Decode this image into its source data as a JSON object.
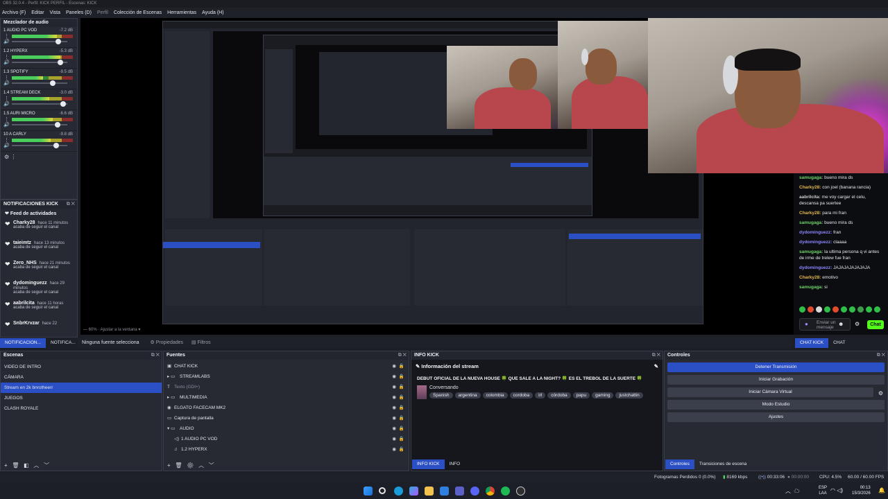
{
  "window": {
    "title": "OBS 32.0.4 - Perfil: KICK PERFIL - Escenas: KICK"
  },
  "menu": [
    {
      "label": "Archivo (F)",
      "dim": false
    },
    {
      "label": "Editar",
      "dim": false
    },
    {
      "label": "Vista",
      "dim": false
    },
    {
      "label": "Paneles (D)",
      "dim": false
    },
    {
      "label": "Perfil",
      "dim": true
    },
    {
      "label": "Colección de Escenas",
      "dim": false
    },
    {
      "label": "Herramientas",
      "dim": false
    },
    {
      "label": "Ayuda (H)",
      "dim": false
    }
  ],
  "mixer": {
    "title": "Mezclador de audio",
    "tracks": [
      {
        "name": "1 AUDIO PC VOD",
        "db": "-7.2 dB",
        "level": 0.72,
        "volume": 0.82
      },
      {
        "name": "1.2 HYPERX",
        "db": "-5.3 dB",
        "level": 0.78,
        "volume": 0.85
      },
      {
        "name": "1.3 SPOTIFY",
        "db": "-9.5 dB",
        "level": 0.5,
        "volume": 0.72
      },
      {
        "name": "1.4 STREAM DECK",
        "db": "-3.0 dB",
        "level": 0.6,
        "volume": 0.9
      },
      {
        "name": "1.5 AURI MICRO",
        "db": "-6.6 dB",
        "level": 0.66,
        "volume": 0.8
      },
      {
        "name": "10 A CARLY",
        "db": "-9.8 dB",
        "level": 0.62,
        "volume": 0.78
      }
    ]
  },
  "notifications": {
    "title": "NOTIFICACIONES KICK",
    "feed_title": "Feed de actividades",
    "items": [
      {
        "name": "Charky28",
        "time": "hace 11 minutos",
        "action": "acaba de seguir el canal"
      },
      {
        "name": "taieimtz",
        "time": "hace 13 minutos",
        "action": "acaba de seguir el canal"
      },
      {
        "name": "Zero_NHS",
        "time": "hace 21 minutos",
        "action": "acaba de seguir el canal"
      },
      {
        "name": "dydominguezz",
        "time": "hace 29 minutos",
        "action": "acaba de seguir el canal"
      },
      {
        "name": "aabrilcita",
        "time": "hace 11 horas",
        "action": "acaba de seguir el canal"
      },
      {
        "name": "SnbrKrvzar",
        "time": "hace 22",
        "action": ""
      }
    ]
  },
  "left_tabs": [
    {
      "label": "NOTIFICACION...",
      "active": true
    },
    {
      "label": "NOTIFICA...",
      "active": false
    }
  ],
  "preview_bar": {
    "no_source": "Ninguna fuente selecciona",
    "properties": "Propiedades",
    "filters": "Filtros"
  },
  "chat": {
    "messages": [
      {
        "user": "samugaga",
        "cls": "u-samugaga",
        "text": "bueno mira ds"
      },
      {
        "user": "Charky28",
        "cls": "u-charky",
        "text": "con joel (banana rancia)"
      },
      {
        "user": "aabrilcita",
        "cls": "u-aab",
        "text": "me voy cargar el celu, descansa pa suertee"
      },
      {
        "user": "Charky28",
        "cls": "u-charky",
        "text": "para mi fran"
      },
      {
        "user": "samugaga",
        "cls": "u-samugaga",
        "text": "bueno mira ds"
      },
      {
        "user": "dydominguezz",
        "cls": "u-dydo",
        "text": "fran"
      },
      {
        "user": "dydominguezz",
        "cls": "u-dydo",
        "text": "claaaa"
      },
      {
        "user": "samugaga",
        "cls": "u-samugaga",
        "text": "la ultima persona q vi antes de irme de trelew fue fran"
      },
      {
        "user": "dydominguezz",
        "cls": "u-dydo",
        "text": "JAJAJAJAJAJAJA"
      },
      {
        "user": "Charky28",
        "cls": "u-charky",
        "text": "emotivo"
      },
      {
        "user": "samugaga",
        "cls": "u-samugaga",
        "text": "si"
      }
    ],
    "input_placeholder": "Enviar un mensaje",
    "send": "Chat",
    "tabs": [
      {
        "label": "CHAT KICK",
        "active": true
      },
      {
        "label": "CHAT",
        "active": false
      }
    ]
  },
  "scenes": {
    "title": "Escenas",
    "items": [
      {
        "label": "VIDEO DE INTRO",
        "selected": false
      },
      {
        "label": "CÁMARA",
        "selected": false
      },
      {
        "label": "Stream en 2k bnrotheerr",
        "selected": true
      },
      {
        "label": "JUEGOS",
        "selected": false
      },
      {
        "label": "CLASH ROYALE",
        "selected": false
      }
    ]
  },
  "sources": {
    "title": "Fuentes",
    "items": [
      {
        "label": "CHAT KICK",
        "icon": "▣",
        "indent": 0
      },
      {
        "label": "STREAMLABS",
        "icon": "▸ ▭",
        "indent": 0
      },
      {
        "label": "Texto (GDI+)",
        "icon": "T",
        "indent": 0,
        "dim": true
      },
      {
        "label": "MULTIMEDIA",
        "icon": "▸ ▭",
        "indent": 0
      },
      {
        "label": "ELGATO FACECAM MK2",
        "icon": "◉",
        "indent": 0
      },
      {
        "label": "Captura de pantalla",
        "icon": "▭",
        "indent": 0
      },
      {
        "label": "AUDIO",
        "icon": "▾ ▭",
        "indent": 0
      },
      {
        "label": "1 AUDIO PC VOD",
        "icon": "◁)",
        "indent": 1
      },
      {
        "label": "1.2 HYPERX",
        "icon": "♫",
        "indent": 1
      }
    ]
  },
  "info": {
    "title": "INFO KICK",
    "section": "Información del stream",
    "headline": "DEBUT OFICIAL DE LA NUEVA HOUSE 🍀 QUE SALE A LA NIGHT? 🍀 ES EL TREBOL DE LA SUERTE 🍀",
    "category": "Conversando",
    "tags": [
      "Spanish",
      "argentina",
      "colombia",
      "cordoba",
      "irl",
      "córdoba",
      "papu",
      "gaming",
      "justchattin"
    ],
    "tabs": [
      {
        "label": "INFO KICK",
        "active": true
      },
      {
        "label": "INFO",
        "active": false
      }
    ]
  },
  "controls": {
    "title": "Controles",
    "buttons": [
      {
        "label": "Detener Transmisión",
        "primary": true
      },
      {
        "label": "Iniciar Grabación",
        "primary": false
      },
      {
        "label": "Iniciar Cámara Virtual",
        "primary": false
      },
      {
        "label": "Modo Estudio",
        "primary": false
      },
      {
        "label": "Ajustes",
        "primary": false
      }
    ],
    "tabs": [
      {
        "label": "Controles",
        "active": true
      },
      {
        "label": "Transiciones de escena",
        "active": false
      }
    ]
  },
  "status": {
    "dropped": "Fotogramas Perdidos 0 (0.0%)",
    "bitrate": "8169 kbps",
    "stream_time": "00:33:06",
    "rec_time": "00:00:00",
    "cpu": "CPU: 4.5%",
    "fps": "60.00 / 60.00 FPS"
  },
  "taskbar": {
    "lang": "ESP",
    "lang2": "LAA",
    "time": "00:13",
    "date": "15/3/2026"
  },
  "colors": {
    "accent": "#2b4fc4",
    "kick_green": "#53fc18"
  }
}
